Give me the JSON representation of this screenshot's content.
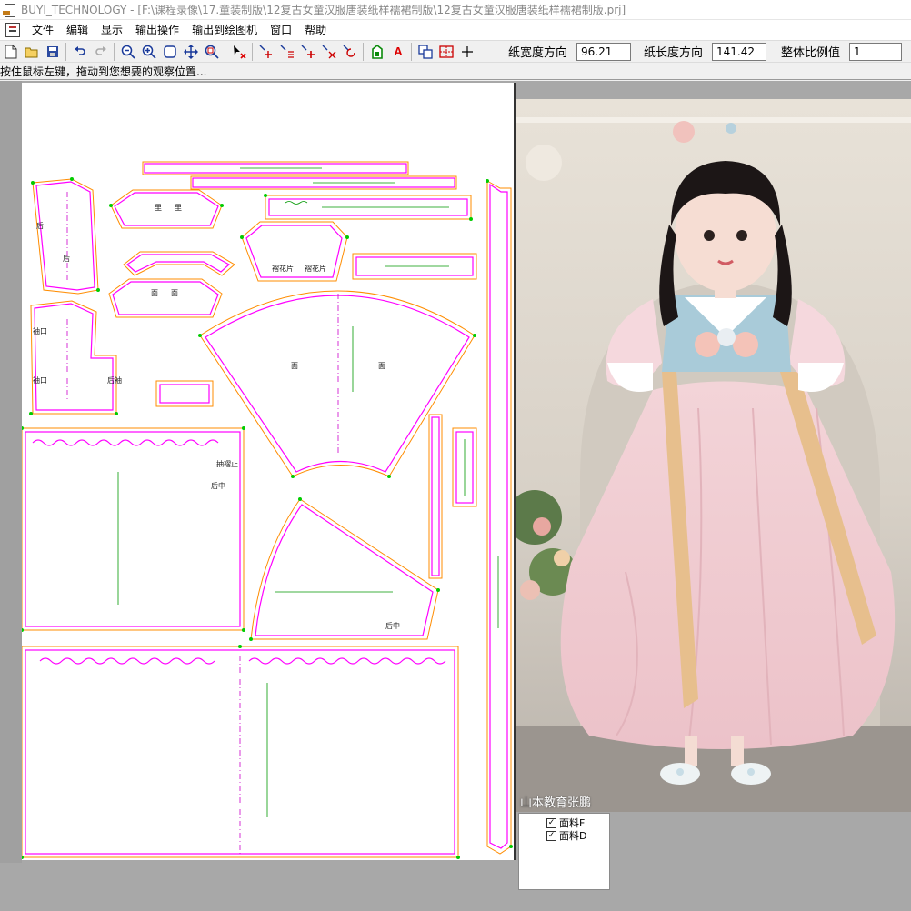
{
  "window": {
    "app_name": "BUYI_TECHNOLOGY",
    "title": "BUYI_TECHNOLOGY - [F:\\课程录像\\17.童装制版\\12复古女童汉服唐装纸样襦裙制版\\12复古女童汉服唐装纸样襦裙制版.prj]"
  },
  "menu": {
    "items": [
      "文件",
      "编辑",
      "显示",
      "输出操作",
      "输出到绘图机",
      "窗口",
      "帮助"
    ]
  },
  "toolbar": {
    "icons": [
      "new-file-icon",
      "open-folder-icon",
      "save-icon",
      "undo-icon",
      "redo-icon",
      "zoom-out-icon",
      "zoom-in-icon",
      "zoom-fit-icon",
      "pan-icon",
      "zoom-window-icon",
      "select-delete-icon",
      "move-piece-icon",
      "rotate-piece-icon",
      "flip-piece-icon",
      "align-piece-icon",
      "reset-icon",
      "piece-outline-icon",
      "text-a-icon",
      "copy-icon",
      "grid-icon",
      "crosshair-icon"
    ],
    "paper_width_label": "纸宽度方向",
    "paper_width_value": "96.21",
    "paper_length_label": "纸长度方向",
    "paper_length_value": "141.42",
    "scale_label": "整体比例值",
    "scale_value": "1"
  },
  "status": {
    "hint": "按住鼠标左键，拖动到您想要的观察位置..."
  },
  "pattern_labels": {
    "back": "后",
    "front": "前",
    "cuff": "袖口",
    "back_sleeve": "后袖",
    "face": "面",
    "ruffle": "褶花片",
    "back_center": "后中",
    "pleat_top": "抽褶止",
    "lining": "里"
  },
  "layer_panel": {
    "items": [
      "面料F",
      "面料D"
    ]
  },
  "photo": {
    "watermark": "山本教育张鹏"
  },
  "colors": {
    "cut_line": "#ff00ff",
    "seam_line": "#ff8c00",
    "point": "#00cc00",
    "grain": "#cc00cc",
    "dress_pink": "#f2c9d0",
    "ribbon": "#e7bf8d"
  }
}
